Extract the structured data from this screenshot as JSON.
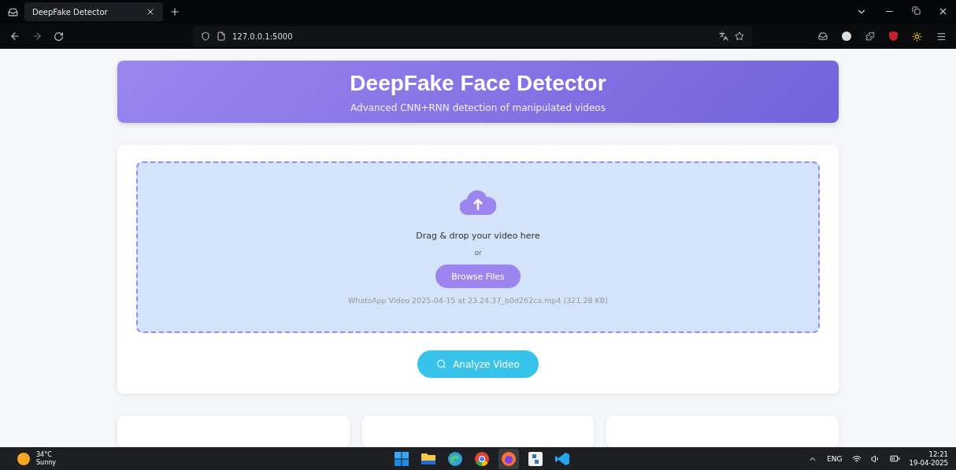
{
  "browser": {
    "tab": {
      "title": "DeepFake Detector",
      "selected": true
    },
    "url": "127.0.0.1:5000"
  },
  "header": {
    "title": "DeepFake Face Detector",
    "subtitle": "Advanced CNN+RNN detection of manipulated videos"
  },
  "upload": {
    "prompt": "Drag & drop your video here",
    "or": "or",
    "browse_button": "Browse Files",
    "file_info": "WhatsApp Video 2025-04-15 at 23.24.37_b0d262ca.mp4 (321.28 KB)"
  },
  "analyze_button": "Analyze Video",
  "result_cards": [
    {
      "kind": "card"
    },
    {
      "kind": "card"
    },
    {
      "kind": "card"
    }
  ],
  "taskbar": {
    "weather": {
      "temp": "34°C",
      "condition": "Sunny"
    },
    "apps": [
      {
        "kind": "windows",
        "selected": false
      },
      {
        "kind": "folder",
        "selected": false
      },
      {
        "kind": "edge",
        "selected": false
      },
      {
        "kind": "chrome",
        "selected": false
      },
      {
        "kind": "firefox",
        "selected": true
      },
      {
        "kind": "python",
        "selected": false
      },
      {
        "kind": "vscode",
        "selected": false
      }
    ],
    "language": "ENG",
    "time": "12:21",
    "date": "19-04-2025"
  }
}
